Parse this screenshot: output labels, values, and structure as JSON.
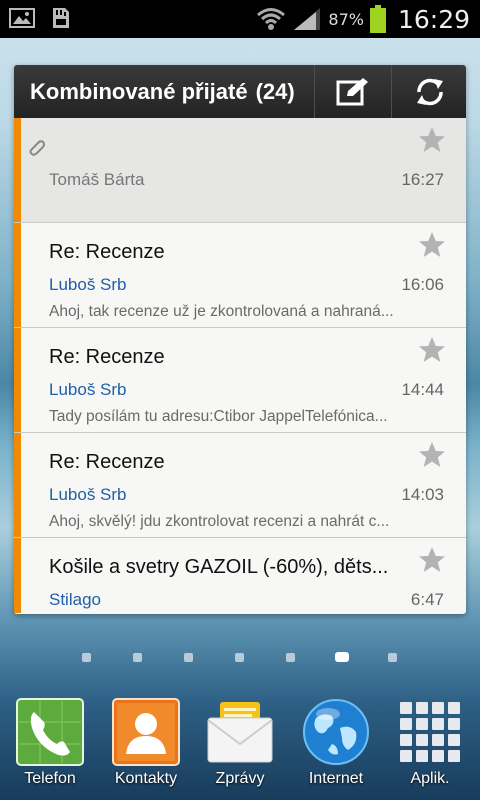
{
  "status_bar": {
    "battery_percent": "87%",
    "time": "16:29",
    "icons": [
      "gallery-icon",
      "sd-card-icon",
      "wifi-icon",
      "signal-icon",
      "battery-icon"
    ]
  },
  "widget": {
    "title": "Kombinované přijaté",
    "count": "(24)",
    "compose_icon": "compose-icon",
    "refresh_icon": "refresh-icon",
    "accent_color": "#f08a00",
    "emails": [
      {
        "subject": "",
        "sender": "Tomáš Bárta",
        "time": "16:27",
        "preview": "",
        "has_attachment": true
      },
      {
        "subject": "Re: Recenze",
        "sender": "Luboš Srb",
        "time": "16:06",
        "preview": "Ahoj, tak recenze už je zkontrolovaná a nahraná..."
      },
      {
        "subject": "Re: Recenze",
        "sender": "Luboš Srb",
        "time": "14:44",
        "preview": "Tady posílám tu adresu:Ctibor JappelTelefónica..."
      },
      {
        "subject": "Re: Recenze",
        "sender": "Luboš Srb",
        "time": "14:03",
        "preview": "Ahoj, skvělý! jdu zkontrolovat recenzi a nahrát c..."
      },
      {
        "subject": "Košile a svetry GAZOIL (-60%), děts...",
        "sender": "Stilago",
        "time": "6:47",
        "preview": ""
      }
    ]
  },
  "home": {
    "page_count": 7,
    "active_page": 6
  },
  "dock": [
    {
      "label": "Telefon",
      "icon": "phone-icon"
    },
    {
      "label": "Kontakty",
      "icon": "contacts-icon"
    },
    {
      "label": "Zprávy",
      "icon": "messages-icon"
    },
    {
      "label": "Internet",
      "icon": "globe-icon"
    },
    {
      "label": "Aplik.",
      "icon": "apps-grid-icon"
    }
  ]
}
